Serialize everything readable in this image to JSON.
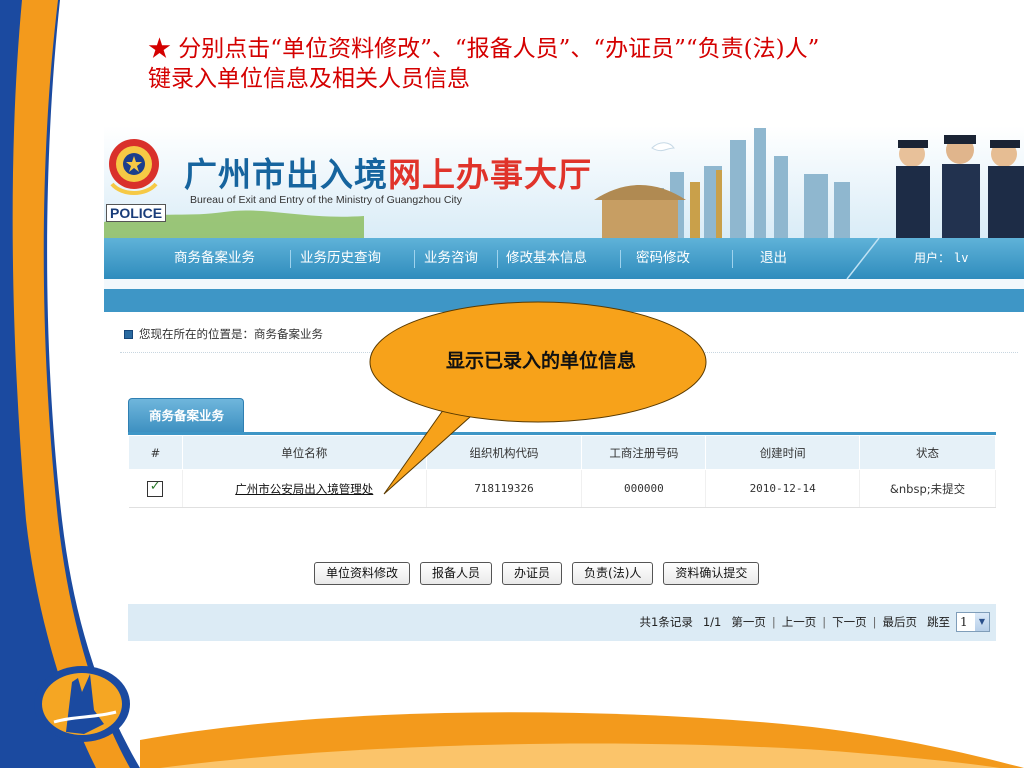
{
  "slide": {
    "instruction_line1": "★ 分别点击“单位资料修改”、“报备人员”、“办证员”“负责(法)人”",
    "instruction_line2": "键录入单位信息及相关人员信息"
  },
  "banner": {
    "title_main": "广州市出入境",
    "title_accent": "网上办事大厅",
    "subtitle": "Bureau of Exit and Entry of the Ministry of Guangzhou City",
    "police_label": "POLICE"
  },
  "nav": {
    "items": [
      "商务备案业务",
      "业务历史查询",
      "业务咨询",
      "修改基本信息",
      "密码修改",
      "退出"
    ],
    "user_label": "用户：",
    "user_value": "lv"
  },
  "breadcrumb": "您现在所在的位置是：商务备案业务",
  "tab": "商务备案业务",
  "table": {
    "headers": [
      "#",
      "单位名称",
      "组织机构代码",
      "工商注册号码",
      "创建时间",
      "状态"
    ],
    "rows": [
      {
        "checked": true,
        "name": "广州市公安局出入境管理处",
        "org_code": "718119326",
        "reg_no": "000000",
        "created": "2010-12-14",
        "status": "&nbsp;未提交"
      }
    ]
  },
  "actions": [
    "单位资料修改",
    "报备人员",
    "办证员",
    "负责(法)人",
    "资料确认提交"
  ],
  "pager": {
    "total": "共1条记录",
    "pages": "1/1",
    "first": "第一页",
    "prev": "上一页",
    "next": "下一页",
    "last": "最后页",
    "jump": "跳至",
    "selected": "1"
  },
  "callout": "显示已录入的单位信息",
  "colors": {
    "slide_orange": "#f39a1c",
    "slide_blue": "#1b4aa0",
    "instruction_red": "#d40000",
    "nav_blue": "#3e96c6",
    "callout_fill": "#f7a21a"
  },
  "icons": [
    "police-badge-icon",
    "check-icon",
    "dropdown-arrow-icon",
    "breadcrumb-icon"
  ]
}
